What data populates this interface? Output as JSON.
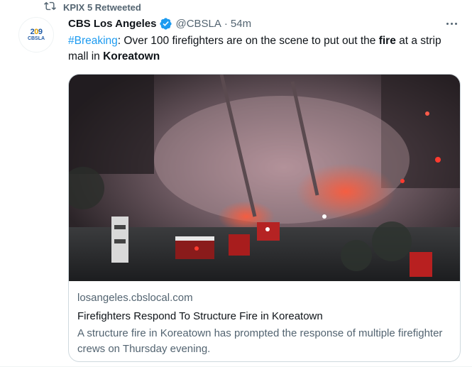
{
  "retweet": {
    "label": "KPIX 5 Retweeted",
    "icon": "retweet-icon"
  },
  "author": {
    "display_name": "CBS Los Angeles",
    "handle": "@CBSLA",
    "separator": "·",
    "time": "54m",
    "verified_icon": "verified-badge-icon",
    "avatar": {
      "logo_digits_a": "2",
      "logo_digits_o": "0",
      "logo_digits_b": "9",
      "logo_sub": "CBSLA"
    }
  },
  "tweet": {
    "hashtag": "#Breaking",
    "part1": ": Over 100 firefighters are on the scene to put out the ",
    "bold1": "fire",
    "part2": " at a strip mall in ",
    "bold2": "Koreatown"
  },
  "card": {
    "domain": "losangeles.cbslocal.com",
    "title": "Firefighters Respond To Structure Fire in Koreatown",
    "description": "A structure fire in Koreatown has prompted the response of multiple firefighter crews on Thursday evening."
  },
  "colors": {
    "accent": "#1d9bf0",
    "secondary_text": "#536471",
    "border": "#cfd9de"
  }
}
